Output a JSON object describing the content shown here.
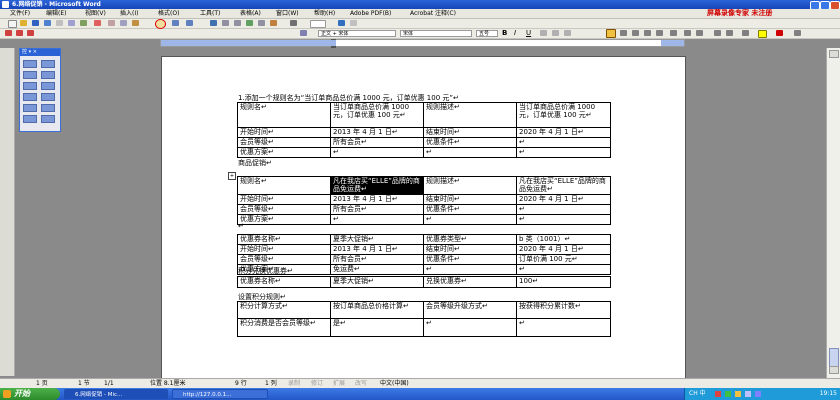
{
  "window": {
    "title": "6.网络促销 - Microsoft Word"
  },
  "menu": {
    "items": [
      "文件(F)",
      "编辑(E)",
      "视图(V)",
      "插入(I)",
      "格式(O)",
      "工具(T)",
      "表格(A)",
      "窗口(W)",
      "帮助(H)",
      "Adobe PDF(B)",
      "Acrobat 注释(C)"
    ],
    "promo": "屏幕录像专家 未注册"
  },
  "format": {
    "style": "正文 + 宋体",
    "font": "宋体",
    "size": "五号",
    "bold": "B",
    "italic": "I",
    "underline": "U"
  },
  "palette": {
    "title": "控 ▾ ×"
  },
  "doc": {
    "line1": "1.添加一个规则名为“当订单商品总价满 1000 元，订单优惠 100 元”↵",
    "table1": [
      [
        "规则名↵",
        "当订单商品总价满 1000 元，订单优惠 100 元↵",
        "规则描述↵",
        "当订单商品总价满 1000 元，订单优惠 100 元↵"
      ],
      [
        "开始时间↵",
        "2013 年 4 月 1 日↵",
        "结束时间↵",
        "2020 年 4 月 1 日↵"
      ],
      [
        "会员等级↵",
        "所有会员↵",
        "优惠条件↵",
        "↵"
      ],
      [
        "优惠方案↵",
        "↵",
        "↵",
        "↵"
      ]
    ],
    "heading2": "商品促销↵",
    "table2": [
      [
        "规则名↵",
        "凡在我店买“ELLE”品牌的商品免运费↵",
        "规则描述↵",
        "凡在我店买“ELLE”品牌的商品免运费↵"
      ],
      [
        "开始时间↵",
        "2013 年 4 月 1 日↵",
        "结束时间↵",
        "2020 年 4 月 1 日↵"
      ],
      [
        "会员等级↵",
        "所有会员↵",
        "优惠条件↵",
        "↵"
      ],
      [
        "优惠方案↵",
        "↵",
        "↵",
        "↵"
      ]
    ],
    "blank": "↵",
    "table3": [
      [
        "优惠券名称↵",
        "夏季大促销↵",
        "优惠券类型↵",
        "b 类（1001）↵"
      ],
      [
        "开始时间↵",
        "2013 年 4 月 1 日↵",
        "结束时间↵",
        "2020 年 4 月 1 日↵"
      ],
      [
        "会员等级↵",
        "所有会员↵",
        "优惠条件↵",
        "订单价满 100 元↵"
      ],
      [
        "优惠方案↵",
        "免运费↵",
        "↵",
        "↵"
      ]
    ],
    "heading3": "积分兑换优惠券↵",
    "table4": [
      [
        "优惠券名称↵",
        "夏季大促销↵",
        "兑换优惠券↵",
        "100↵"
      ]
    ],
    "heading4": "设置积分规则↵",
    "table5": [
      [
        "积分计算方式↵",
        "按订单商品总价格计算↵",
        "会员等级升级方式↵",
        "按获得积分累计数↵"
      ],
      [
        "积分消费是否会员等级↵",
        "是↵",
        "↵",
        "↵"
      ]
    ]
  },
  "status": {
    "page": "1 页",
    "section": "1 节",
    "pages": "1/1",
    "position": "位置 8.1厘米",
    "line": "9 行",
    "col": "1 列",
    "rec": "录制",
    "trk": "修订",
    "ext": "扩展",
    "ovr": "改写",
    "lang": "中文(中国)"
  },
  "taskbar": {
    "start": "开始",
    "tasks": [
      "6.网络促销 - Mic...",
      "http://127.0.0.1..."
    ],
    "tray_text": "CH 中",
    "clock": "19:15"
  }
}
